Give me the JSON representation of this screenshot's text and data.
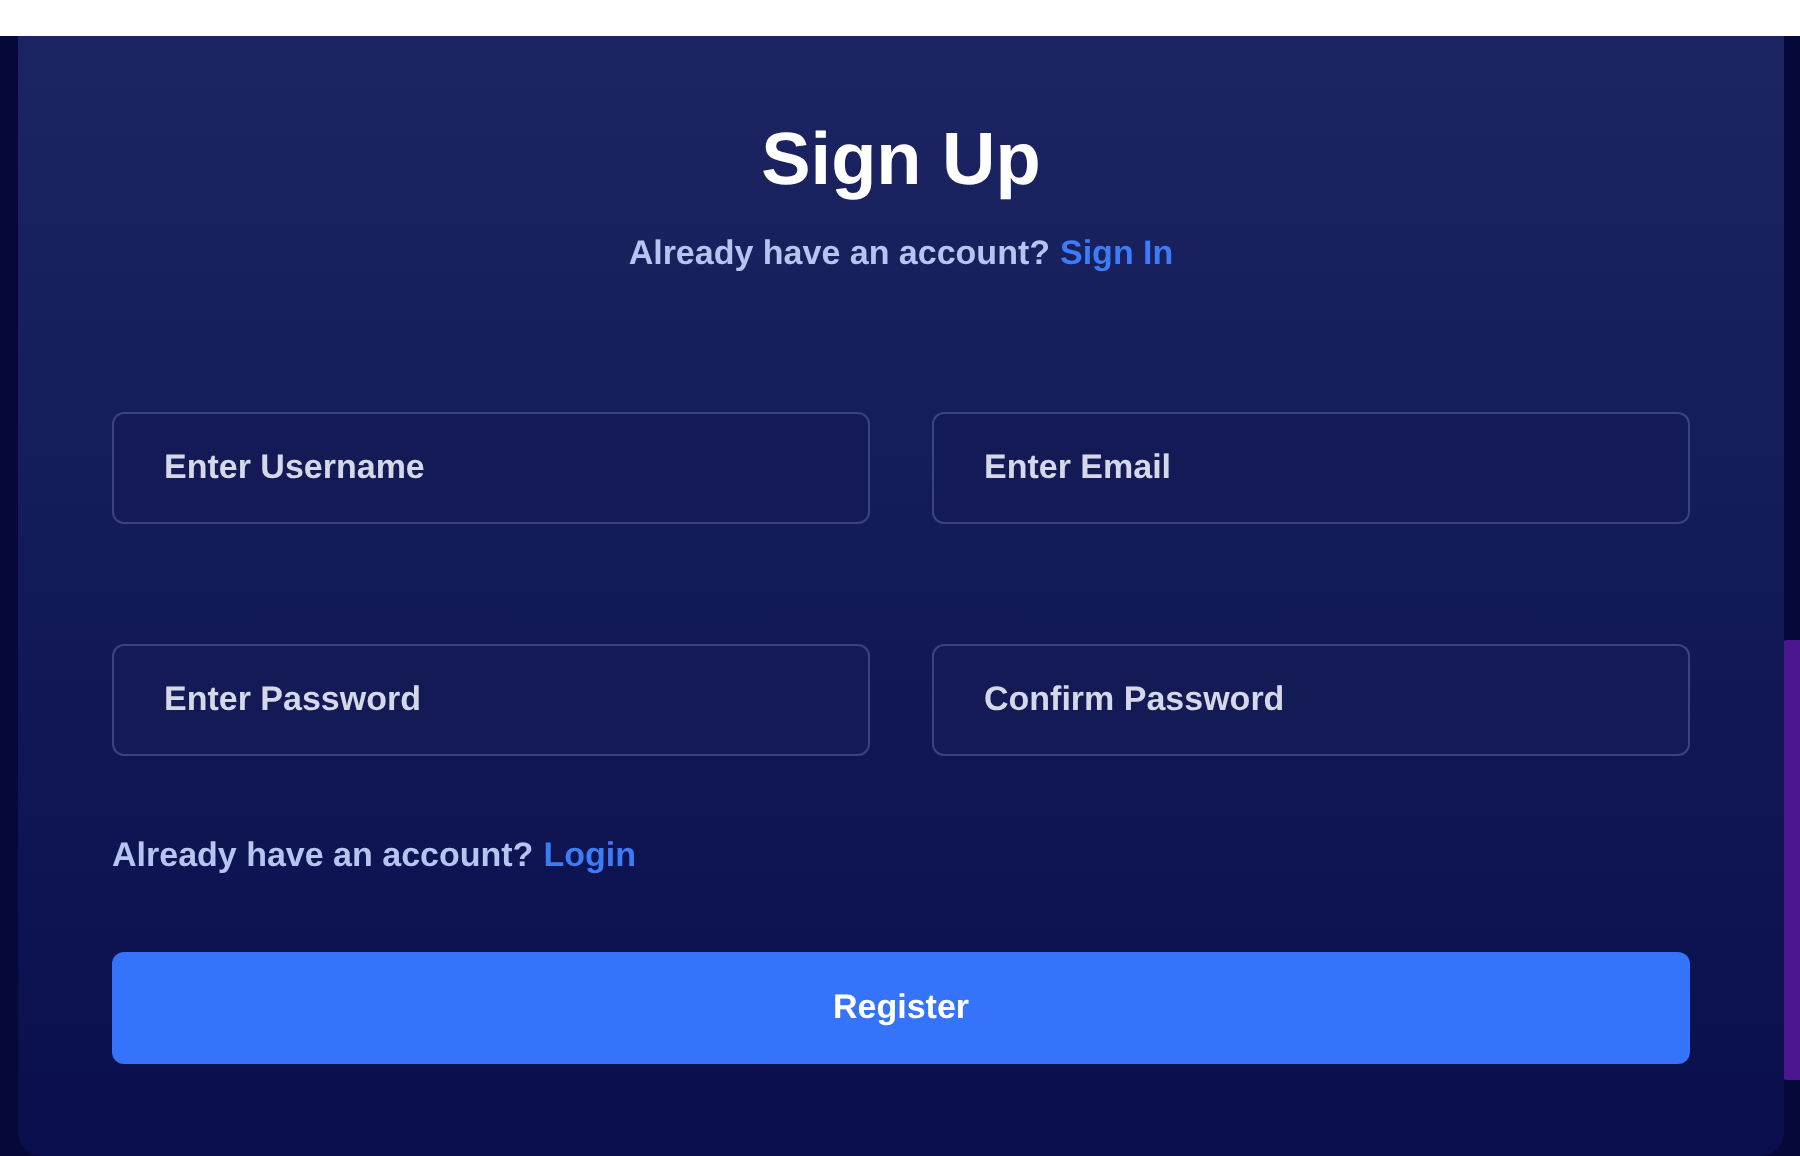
{
  "title": "Sign Up",
  "subtitle": {
    "text": "Already have an account?",
    "link": "Sign In"
  },
  "fields": [
    {
      "placeholder": "Enter Username"
    },
    {
      "placeholder": "Enter Email"
    },
    {
      "placeholder": "Enter Password"
    },
    {
      "placeholder": "Confirm Password"
    }
  ],
  "login_prompt": {
    "text": "Already have an account?",
    "link": "Login"
  },
  "submit_button": "Register"
}
